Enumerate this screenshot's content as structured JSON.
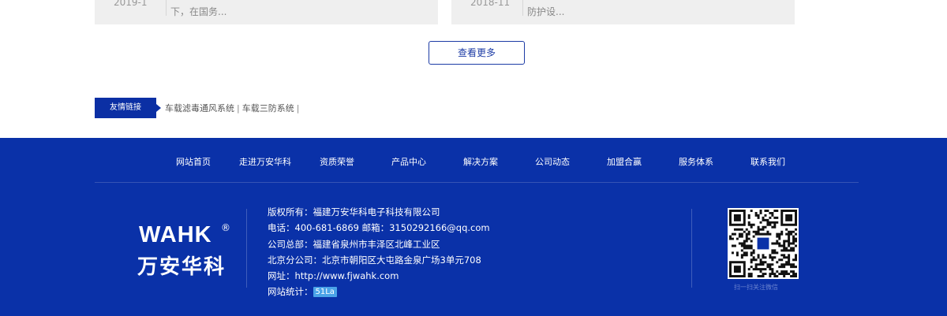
{
  "news": [
    {
      "date": "2019-1",
      "excerpt": "下，在国务..."
    },
    {
      "date": "2018-11",
      "excerpt": "防护设..."
    }
  ],
  "more_button": "查看更多",
  "links": {
    "label": "友情链接",
    "items": [
      "车载滤毒通风系统",
      "车载三防系统"
    ]
  },
  "footer": {
    "nav": [
      "网站首页",
      "走进万安华科",
      "资质荣誉",
      "产品中心",
      "解决方案",
      "公司动态",
      "加盟合赢",
      "服务体系",
      "联系我们"
    ],
    "logo_text": "WAHK",
    "logo_reg": "®",
    "logo_cn": "万安华科",
    "info": {
      "copyright": "版权所有：福建万安华科电子科技有限公司",
      "contact": "电话：400-681-6869  邮箱：3150292166@qq.com",
      "hq": "公司总部：福建省泉州市丰泽区北峰工业区",
      "beijing": "北京分公司：北京市朝阳区大屯路金泉广场3单元708",
      "website": "网址：http://www.fjwahk.com",
      "stats_label": "网站统计：",
      "stats_badge": "51La"
    },
    "qr_caption": "扫一扫关注微信"
  },
  "colors": {
    "brand_blue": "#0a31a8",
    "button_border": "#1c3ba5",
    "badge": "#4aa3e8"
  },
  "icons": {
    "links_arrow": "triangle-right-icon",
    "qr": "qr-code-icon"
  }
}
